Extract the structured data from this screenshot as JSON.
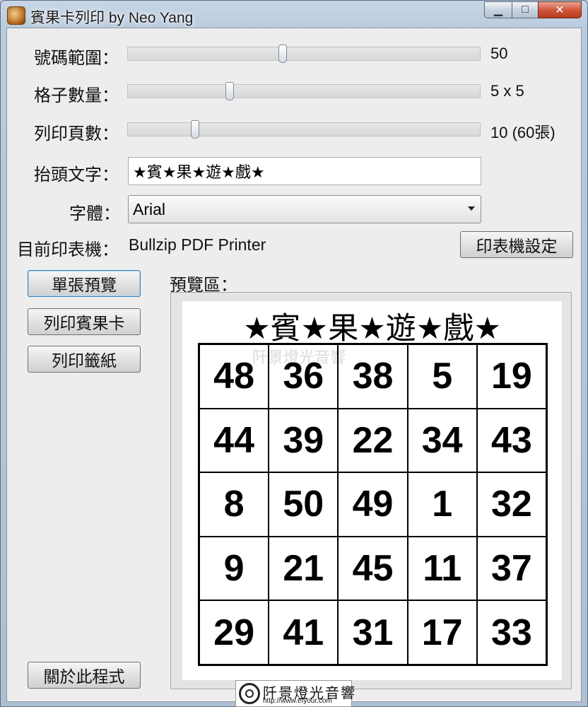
{
  "window": {
    "title": "賓果卡列印 by Neo Yang",
    "controls": {
      "minimize": "▁",
      "maximize": "□",
      "close": "✕"
    }
  },
  "settings": {
    "range": {
      "label": "號碼範圍：",
      "value": "50",
      "slider_fraction": 0.44
    },
    "grid_size": {
      "label": "格子數量：",
      "value": "5 x 5",
      "slider_fraction": 0.29
    },
    "pages": {
      "label": "列印頁數：",
      "value": "10 (60張)",
      "slider_fraction": 0.19
    },
    "header_text": {
      "label": "抬頭文字：",
      "value": "★賓★果★遊★戲★"
    },
    "font": {
      "label": "字體：",
      "value": "Arial"
    },
    "printer": {
      "label": "目前印表機：",
      "value": "Bullzip PDF Printer"
    }
  },
  "buttons": {
    "printer_setup": "印表機設定",
    "preview_single": "單張預覽",
    "print_cards": "列印賓果卡",
    "print_lots": "列印籤紙",
    "about": "關於此程式"
  },
  "preview": {
    "label": "預覽區：",
    "card_title": "★賓★果★遊★戲★",
    "rows": [
      [
        "48",
        "36",
        "38",
        "5",
        "19"
      ],
      [
        "44",
        "39",
        "22",
        "34",
        "43"
      ],
      [
        "8",
        "50",
        "49",
        "1",
        "32"
      ],
      [
        "9",
        "21",
        "45",
        "11",
        "37"
      ],
      [
        "29",
        "41",
        "31",
        "17",
        "33"
      ]
    ]
  },
  "watermark": {
    "name": "阡景燈光音響",
    "url": "http://www.efyour.com"
  }
}
